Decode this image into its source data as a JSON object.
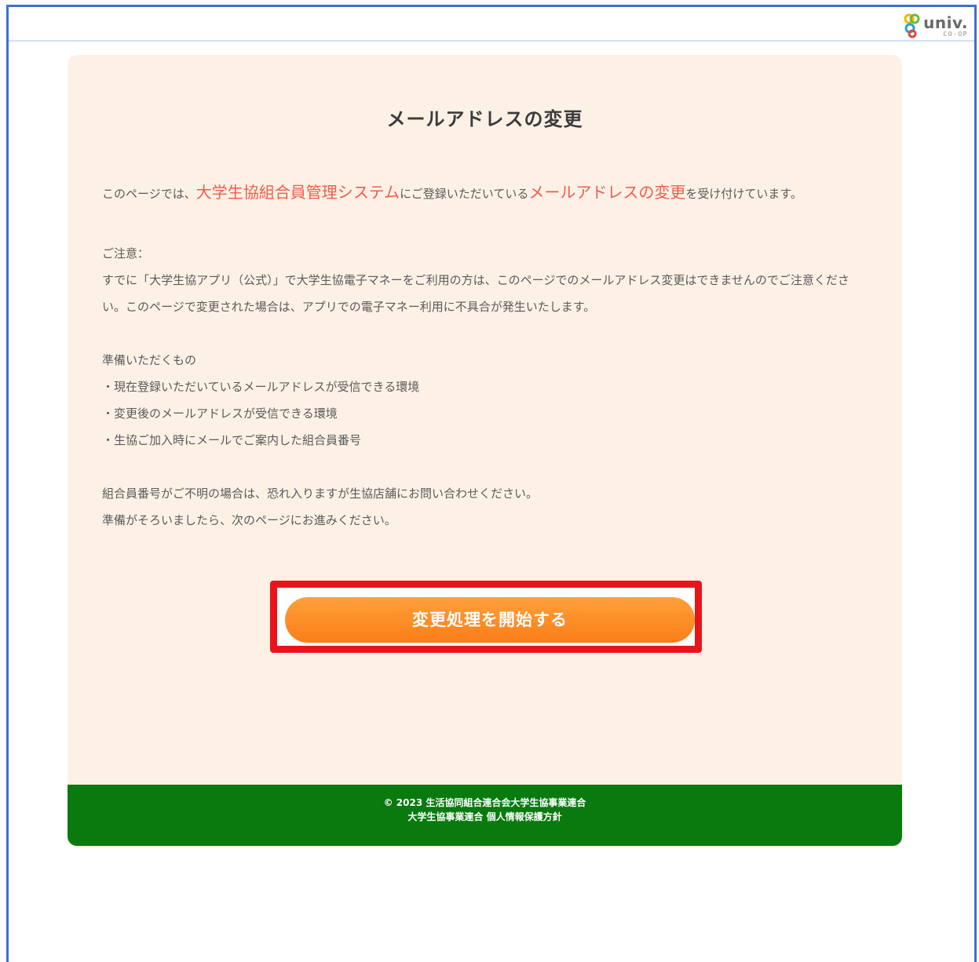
{
  "header": {
    "logo": {
      "text": "univ.",
      "subtext": "CO-OP"
    }
  },
  "main": {
    "title": "メールアドレスの変更",
    "intro": {
      "prefix": "このページでは、",
      "system_name": "大学生協組合員管理システム",
      "middle": "にご登録いただいている",
      "feature_name": "メールアドレスの変更",
      "suffix": "を受け付けています。"
    },
    "notice": {
      "heading": "ご注意：",
      "body": "すでに「大学生協アプリ（公式）」で大学生協電子マネーをご利用の方は、このページでのメールアドレス変更はできませんのでご注意ください。このページで変更された場合は、アプリでの電子マネー利用に不具合が発生いたします。"
    },
    "prepare": {
      "heading": "準備いただくもの",
      "items": [
        "・現在登録いただいているメールアドレスが受信できる環境",
        "・変更後のメールアドレスが受信できる環境",
        "・生協ご加入時にメールでご案内した組合員番号"
      ]
    },
    "closing": [
      "組合員番号がご不明の場合は、恐れ入りますが生協店舗にお問い合わせください。",
      "準備がそろいましたら、次のページにお進みください。"
    ],
    "start_button_label": "変更処理を開始する"
  },
  "footer": {
    "copyright": "© 2023 生活協同組合連合会大学生協事業連合",
    "org_link": "大学生協事業連合",
    "privacy_link": "個人情報保護方針"
  },
  "colors": {
    "panel_bg": "#fdf1e6",
    "highlight": "#f05d4a",
    "button": "#fb8a20",
    "callout_border": "#e8141a",
    "footer_bg": "#087a0e",
    "frame_border": "#3f6fd1"
  }
}
